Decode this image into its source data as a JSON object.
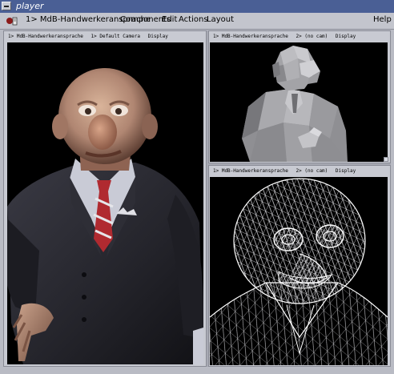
{
  "window": {
    "title": "player"
  },
  "menubar": {
    "scene": "1> MdB-Handwerkeransprache",
    "items": [
      "Components",
      "Edit",
      "Actions",
      "Layout"
    ],
    "help": "Help"
  },
  "panes": {
    "left": {
      "scene": "1> MdB-Handwerkeransprache",
      "camera": "1> Default Camera",
      "mode": "Display",
      "render": "shaded-character"
    },
    "top": {
      "scene": "1> MdB-Handwerkeransprache",
      "camera": "2> (no cam)",
      "mode": "Display",
      "render": "flat-shaded-grey"
    },
    "bottom": {
      "scene": "1> MdB-Handwerkeransprache",
      "camera": "2> (no cam)",
      "mode": "Display",
      "render": "wireframe"
    }
  },
  "colors": {
    "titlebar": "#4a5f95",
    "chrome": "#c3c5cd",
    "viewport": "#000000"
  }
}
